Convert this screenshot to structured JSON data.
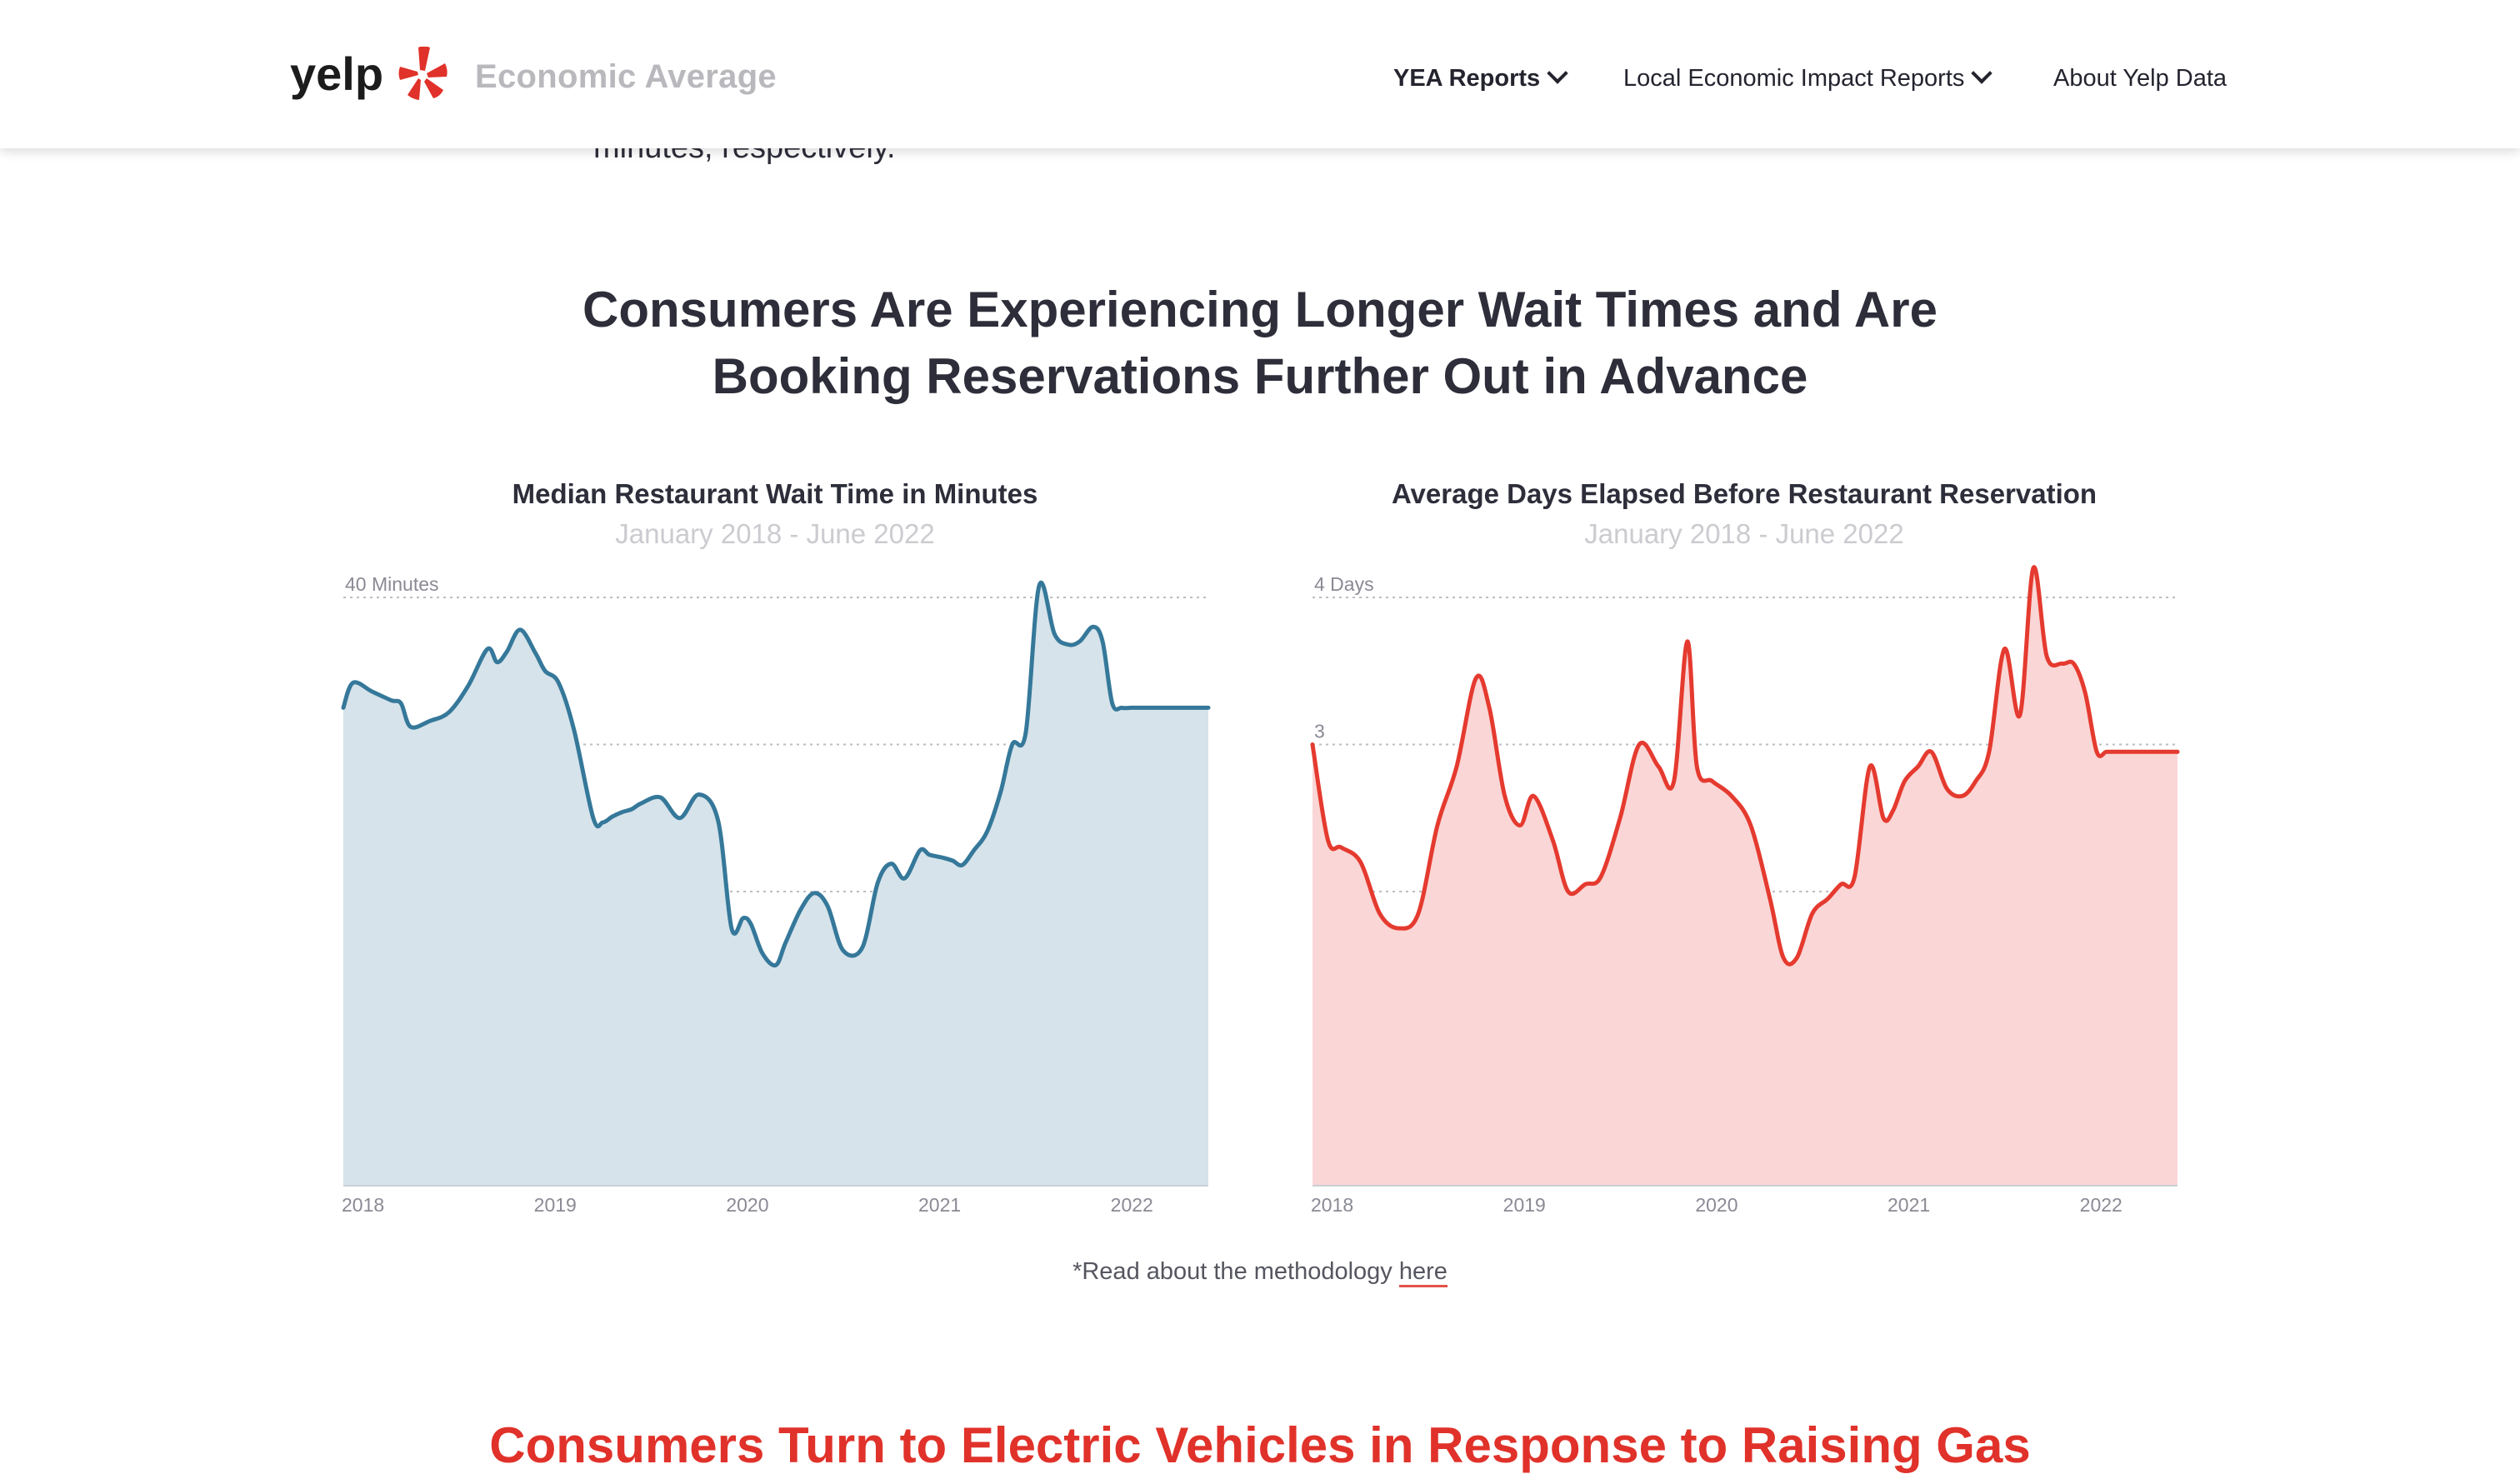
{
  "header": {
    "logo_text": "yelp",
    "brand_subtitle": "Economic Average",
    "nav": [
      {
        "label": "YEA Reports",
        "has_dropdown": true
      },
      {
        "label": "Local Economic Impact Reports",
        "has_dropdown": true
      },
      {
        "label": "About Yelp Data",
        "has_dropdown": false
      }
    ],
    "brand_color": "#d32323"
  },
  "body": {
    "scrolled_text": "minutes, respectively.",
    "section_title_line1": "Consumers Are Experiencing Longer Wait Times and Are",
    "section_title_line2": "Booking Reservations Further Out in Advance",
    "methodology_prefix": "*Read about the methodology ",
    "methodology_link": "here",
    "next_section_title": "Consumers Turn to Electric Vehicles in Response to Raising Gas"
  },
  "chart_data": [
    {
      "type": "area",
      "title": "Median Restaurant Wait Time in Minutes",
      "subtitle": "January 2018 - June 2022",
      "color": "#35789a",
      "fill": "#d6e3ea",
      "ylim": [
        0,
        40
      ],
      "yticks": [
        "0",
        "10",
        "20",
        "30",
        "40 Minutes"
      ],
      "xticks": [
        {
          "label": "2018",
          "x": 2018.0
        },
        {
          "label": "2019",
          "x": 2019.0
        },
        {
          "label": "2020",
          "x": 2020.0
        },
        {
          "label": "2021",
          "x": 2021.0
        },
        {
          "label": "2022",
          "x": 2022.0
        }
      ],
      "grid": true,
      "x": [
        2018.0,
        2018.05,
        2018.15,
        2018.25,
        2018.3,
        2018.35,
        2018.45,
        2018.55,
        2018.65,
        2018.75,
        2018.8,
        2018.85,
        2018.92,
        2019.0,
        2019.05,
        2019.12,
        2019.2,
        2019.3,
        2019.35,
        2019.4,
        2019.45,
        2019.5,
        2019.55,
        2019.65,
        2019.75,
        2019.85,
        2019.95,
        2020.02,
        2020.08,
        2020.12,
        2020.18,
        2020.25,
        2020.3,
        2020.38,
        2020.45,
        2020.52,
        2020.6,
        2020.7,
        2020.78,
        2020.85,
        2020.92,
        2021.0,
        2021.05,
        2021.12,
        2021.17,
        2021.22,
        2021.28,
        2021.35,
        2021.42,
        2021.48,
        2021.55,
        2021.62,
        2021.7,
        2021.77,
        2021.83,
        2021.9,
        2021.95,
        2022.0,
        2022.05,
        2022.1,
        2022.15,
        2022.2,
        2022.25,
        2022.3,
        2022.35,
        2022.42,
        2022.5
      ],
      "values": [
        32.5,
        34.2,
        33.6,
        33.0,
        32.8,
        31.2,
        31.6,
        32.2,
        34.0,
        36.5,
        35.6,
        36.3,
        37.8,
        36.2,
        35.0,
        34.2,
        31.0,
        25.0,
        24.7,
        25.1,
        25.4,
        25.6,
        26.0,
        26.4,
        25.0,
        26.6,
        24.8,
        17.5,
        18.2,
        17.8,
        15.8,
        15.0,
        16.5,
        18.8,
        19.9,
        19.0,
        16.0,
        16.2,
        20.6,
        21.9,
        20.9,
        22.8,
        22.5,
        22.3,
        22.1,
        21.8,
        22.8,
        24.1,
        26.8,
        30.0,
        30.8,
        40.8,
        37.5,
        36.8,
        37.0,
        38.0,
        37.0,
        32.8,
        32.5,
        32.5,
        32.5,
        32.5,
        32.5,
        32.5,
        32.5,
        32.5,
        32.5
      ]
    },
    {
      "type": "area",
      "title": "Average Days Elapsed Before Restaurant Reservation",
      "subtitle": "January 2018 - June 2022",
      "color": "#e53a2f",
      "fill": "#fad6d6",
      "ylim": [
        0,
        4
      ],
      "yticks": [
        "0",
        "1",
        "2",
        "3",
        "4 Days"
      ],
      "xticks": [
        {
          "label": "2018",
          "x": 2018.0
        },
        {
          "label": "2019",
          "x": 2019.0
        },
        {
          "label": "2020",
          "x": 2020.0
        },
        {
          "label": "2021",
          "x": 2021.0
        },
        {
          "label": "2022",
          "x": 2022.0
        }
      ],
      "grid": true,
      "x": [
        2018.0,
        2018.08,
        2018.15,
        2018.25,
        2018.35,
        2018.45,
        2018.55,
        2018.65,
        2018.75,
        2018.85,
        2018.92,
        2019.0,
        2019.08,
        2019.15,
        2019.25,
        2019.33,
        2019.42,
        2019.5,
        2019.6,
        2019.7,
        2019.8,
        2019.88,
        2019.95,
        2020.0,
        2020.08,
        2020.18,
        2020.28,
        2020.38,
        2020.45,
        2020.52,
        2020.6,
        2020.68,
        2020.75,
        2020.82,
        2020.9,
        2020.97,
        2021.02,
        2021.08,
        2021.15,
        2021.22,
        2021.3,
        2021.38,
        2021.45,
        2021.52,
        2021.6,
        2021.68,
        2021.75,
        2021.82,
        2021.9,
        2021.96,
        2022.02,
        2022.08,
        2022.13,
        2022.18,
        2022.25,
        2022.33,
        2022.42,
        2022.5
      ],
      "values": [
        3.0,
        2.35,
        2.3,
        2.2,
        1.85,
        1.75,
        1.85,
        2.45,
        2.85,
        3.45,
        3.25,
        2.65,
        2.45,
        2.65,
        2.35,
        2.0,
        2.05,
        2.1,
        2.5,
        3.0,
        2.85,
        2.75,
        3.7,
        2.85,
        2.75,
        2.65,
        2.45,
        1.95,
        1.55,
        1.55,
        1.85,
        1.95,
        2.05,
        2.1,
        2.85,
        2.5,
        2.55,
        2.75,
        2.85,
        2.95,
        2.7,
        2.65,
        2.75,
        2.95,
        3.65,
        3.2,
        4.2,
        3.6,
        3.55,
        3.55,
        3.35,
        2.95,
        2.95,
        2.95,
        2.95,
        2.95,
        2.95,
        2.95
      ]
    }
  ]
}
